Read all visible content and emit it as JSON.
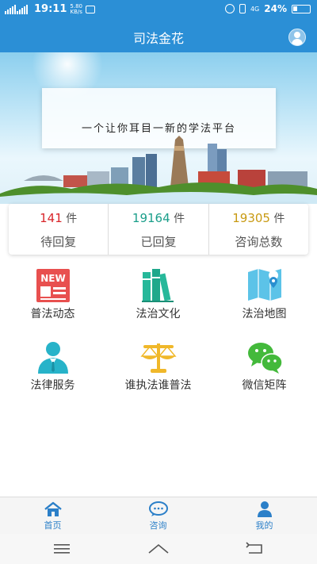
{
  "status_bar": {
    "signal_label": "G 4G",
    "time": "19:11",
    "speed_value": "5.80",
    "speed_unit": "KB/s",
    "network": "4G",
    "battery": "24%"
  },
  "header": {
    "title": "司法金花"
  },
  "banner": {
    "slogan": "一个让你耳目一新的学法平台"
  },
  "stats": [
    {
      "value": "141",
      "unit": "件",
      "label": "待回复",
      "color": "#d9262b"
    },
    {
      "value": "19164",
      "unit": "件",
      "label": "已回复",
      "color": "#1a9e8a"
    },
    {
      "value": "19305",
      "unit": "件",
      "label": "咨询总数",
      "color": "#c89a12"
    }
  ],
  "features": [
    {
      "label": "普法动态",
      "icon": "news-icon",
      "badge": "NEW"
    },
    {
      "label": "法治文化",
      "icon": "books-icon"
    },
    {
      "label": "法治地图",
      "icon": "map-icon"
    },
    {
      "label": "法律服务",
      "icon": "lawyer-icon"
    },
    {
      "label": "谁执法谁普法",
      "icon": "scales-icon"
    },
    {
      "label": "微信矩阵",
      "icon": "wechat-icon"
    }
  ],
  "bottom_nav": [
    {
      "label": "首页",
      "icon": "home-icon"
    },
    {
      "label": "咨询",
      "icon": "chat-icon"
    },
    {
      "label": "我的",
      "icon": "profile-icon"
    }
  ],
  "colors": {
    "primary": "#2b8fd6",
    "nav_text": "#2b7fc8"
  }
}
